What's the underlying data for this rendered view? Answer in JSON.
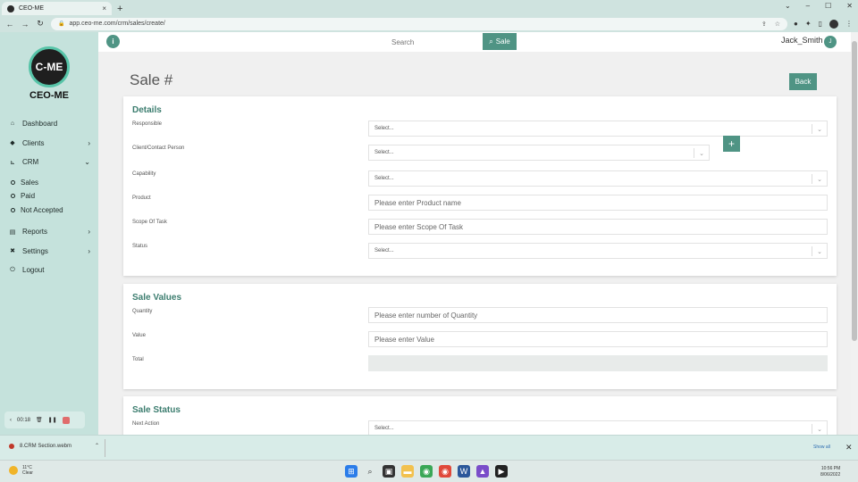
{
  "browser": {
    "tab_title": "CEO-ME",
    "tab_close": "×",
    "new_tab": "+",
    "url": "app.ceo-me.com/crm/sales/create/",
    "win_min": "⌄",
    "win_restore": "–",
    "win_max": "☐",
    "win_close": "✕"
  },
  "sidebar": {
    "logo_mark": "C-ME",
    "logo_text": "CEO-ME",
    "items": [
      {
        "label": "Dashboard",
        "icon": "home-icon"
      },
      {
        "label": "Clients",
        "icon": "clients-icon",
        "chevron": "›"
      },
      {
        "label": "CRM",
        "icon": "crm-icon",
        "chevron": "⌄"
      }
    ],
    "submenu": [
      "Sales",
      "Paid",
      "Not Accepted"
    ],
    "items2": [
      {
        "label": "Reports",
        "icon": "reports-icon",
        "chevron": "›"
      },
      {
        "label": "Settings",
        "icon": "settings-icon",
        "chevron": "›"
      },
      {
        "label": "Logout",
        "icon": "logout-icon"
      }
    ],
    "recorder_time": "00:18"
  },
  "topbar": {
    "info": "i",
    "search_placeholder": "Search",
    "search_button": "Sale",
    "user_name": "Jack_Smith",
    "user_initial": "J"
  },
  "page": {
    "title": "Sale #",
    "back": "Back"
  },
  "details": {
    "heading": "Details",
    "responsible_label": "Responsible",
    "responsible_value": "Select...",
    "client_label": "Client/Contact Person",
    "client_value": "Select...",
    "add_button": "+",
    "capability_label": "Capability",
    "capability_value": "Select...",
    "product_label": "Product",
    "product_placeholder": "Please enter Product name",
    "scope_label": "Scope Of Task",
    "scope_placeholder": "Please enter Scope Of Task",
    "status_label": "Status",
    "status_value": "Select..."
  },
  "sale_values": {
    "heading": "Sale Values",
    "quantity_label": "Quantity",
    "quantity_placeholder": "Please enter number of Quantity",
    "value_label": "Value",
    "value_placeholder": "Please enter Value",
    "total_label": "Total"
  },
  "sale_status": {
    "heading": "Sale Status",
    "next_action_label": "Next Action",
    "next_action_value": "Select..."
  },
  "downloads": {
    "file": "8.CRM Section.webm",
    "show_all": "Show all"
  },
  "taskbar": {
    "temp": "11°C",
    "condition": "Clear",
    "time": "10:56 PM",
    "date": "8/06/2022"
  },
  "colors": {
    "primary": "#4f9484",
    "sidebar_bg": "#c5e2dc",
    "heading": "#3c7d6f"
  }
}
